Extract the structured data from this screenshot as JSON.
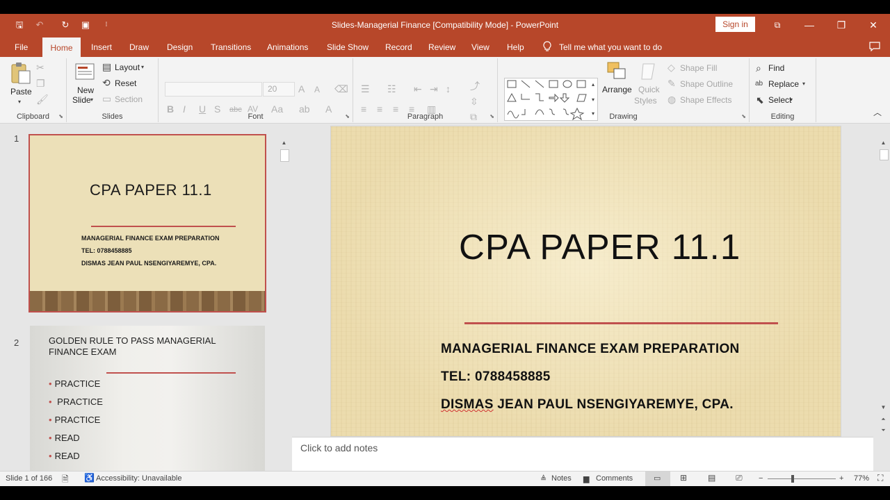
{
  "window": {
    "title": "Slides-Managerial Finance [Compatibility Mode]  -  PowerPoint",
    "sign_in": "Sign in",
    "minimize_glyph": "—",
    "restore_glyph": "❐",
    "close_glyph": "✕",
    "ribbon_display_glyph": "⧉"
  },
  "quick_access": {
    "save_icon": "save-icon",
    "undo_icon": "undo-icon",
    "redo_icon": "redo-icon",
    "present_icon": "start-from-beginning-icon",
    "customize_icon": "customize-icon",
    "save_glyph": "🖫",
    "undo_glyph": "↶",
    "redo_glyph": "↻",
    "present_glyph": "▣",
    "customize_glyph": "⁝"
  },
  "tabs": [
    "File",
    "Home",
    "Insert",
    "Draw",
    "Design",
    "Transitions",
    "Animations",
    "Slide Show",
    "Record",
    "Review",
    "View",
    "Help"
  ],
  "tell_me": "Tell me what you want to do",
  "ribbon": {
    "clipboard": {
      "label": "Clipboard",
      "paste": "Paste"
    },
    "slides": {
      "label": "Slides",
      "new_slide_1": "New",
      "new_slide_2": "Slide",
      "layout": "Layout",
      "reset": "Reset",
      "section": "Section"
    },
    "font": {
      "label": "Font",
      "font_size": "20"
    },
    "paragraph": {
      "label": "Paragraph"
    },
    "drawing": {
      "label": "Drawing",
      "arrange": "Arrange",
      "quick_styles_1": "Quick",
      "quick_styles_2": "Styles",
      "shape_fill": "Shape Fill",
      "shape_outline": "Shape Outline",
      "shape_effects": "Shape Effects"
    },
    "editing": {
      "label": "Editing",
      "find": "Find",
      "replace": "Replace",
      "select": "Select"
    }
  },
  "thumbnails": [
    {
      "number": "1",
      "title": "CPA PAPER 11.1",
      "lines": [
        "MANAGERIAL FINANCE EXAM PREPARATION",
        "TEL: 0788458885",
        "DISMAS JEAN PAUL NSENGIYAREMYE, CPA."
      ]
    },
    {
      "number": "2",
      "title": "GOLDEN RULE TO PASS MANAGERIAL FINANCE EXAM",
      "bullets": [
        "PRACTICE",
        " PRACTICE",
        "PRACTICE",
        "READ",
        "READ"
      ],
      "bullet_glyph": "•"
    }
  ],
  "slide": {
    "title": "CPA PAPER 11.1",
    "line1": "MANAGERIAL FINANCE EXAM PREPARATION",
    "line2": "TEL: 0788458885",
    "line3_name": "DISMAS",
    "line3_rest": " JEAN PAUL NSENGIYAREMYE, CPA."
  },
  "notes_placeholder": "Click to add notes",
  "status": {
    "slide_count": "Slide 1 of 166",
    "accessibility": "Accessibility: Unavailable",
    "notes": "Notes",
    "comments": "Comments",
    "zoom": "77%",
    "zoom_level": 0.77
  },
  "colors": {
    "accent": "#b7472a",
    "divider": "#c0504d"
  }
}
